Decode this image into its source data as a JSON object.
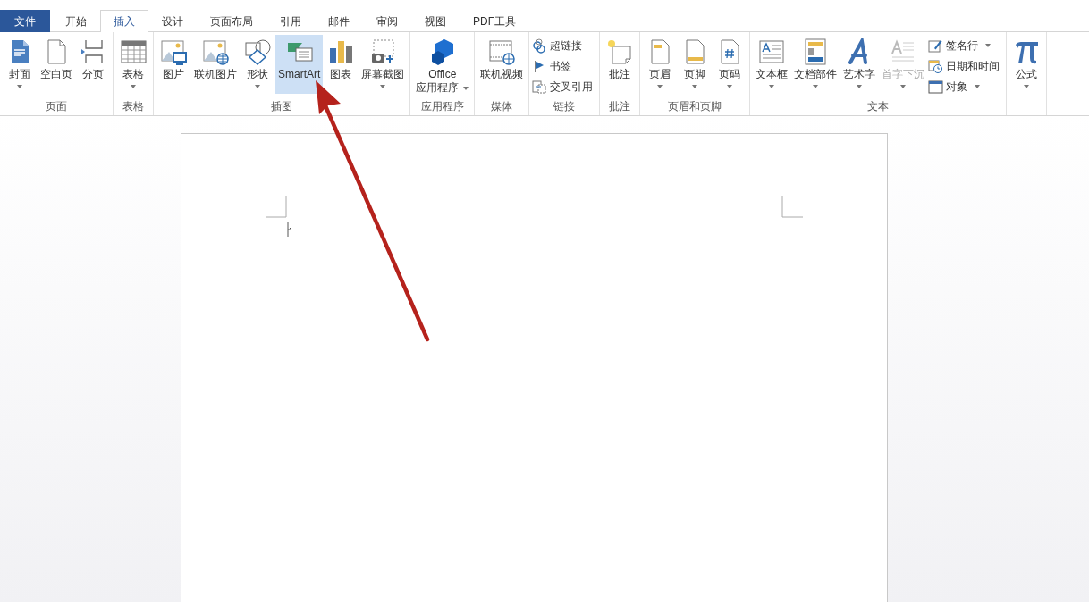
{
  "tabs": [
    {
      "label": "文件",
      "kind": "file",
      "selected": false
    },
    {
      "label": "开始",
      "kind": "tab",
      "selected": false
    },
    {
      "label": "插入",
      "kind": "tab",
      "selected": true
    },
    {
      "label": "设计",
      "kind": "tab",
      "selected": false
    },
    {
      "label": "页面布局",
      "kind": "tab",
      "selected": false
    },
    {
      "label": "引用",
      "kind": "tab",
      "selected": false
    },
    {
      "label": "邮件",
      "kind": "tab",
      "selected": false
    },
    {
      "label": "审阅",
      "kind": "tab",
      "selected": false
    },
    {
      "label": "视图",
      "kind": "tab",
      "selected": false
    },
    {
      "label": "PDF工具",
      "kind": "tab",
      "selected": false
    }
  ],
  "ribbon": {
    "groups": [
      {
        "label": "页面",
        "items": [
          {
            "kind": "large",
            "label": "封面",
            "dropdown": true,
            "highlighted": false,
            "disabled": false
          },
          {
            "kind": "large",
            "label": "空白页",
            "dropdown": false,
            "highlighted": false,
            "disabled": false
          },
          {
            "kind": "large",
            "label": "分页",
            "dropdown": false,
            "highlighted": false,
            "disabled": false
          }
        ]
      },
      {
        "label": "表格",
        "items": [
          {
            "kind": "large",
            "label": "表格",
            "dropdown": true,
            "highlighted": false,
            "disabled": false
          }
        ]
      },
      {
        "label": "插图",
        "items": [
          {
            "kind": "large",
            "label": "图片",
            "dropdown": false,
            "highlighted": false,
            "disabled": false
          },
          {
            "kind": "large",
            "label": "联机图片",
            "dropdown": false,
            "highlighted": false,
            "disabled": false
          },
          {
            "kind": "large",
            "label": "形状",
            "dropdown": true,
            "highlighted": false,
            "disabled": false
          },
          {
            "kind": "large",
            "label": "SmartArt",
            "dropdown": false,
            "highlighted": true,
            "disabled": false
          },
          {
            "kind": "large",
            "label": "图表",
            "dropdown": false,
            "highlighted": false,
            "disabled": false
          },
          {
            "kind": "large",
            "label": "屏幕截图",
            "dropdown": true,
            "highlighted": false,
            "disabled": false
          }
        ]
      },
      {
        "label": "应用程序",
        "items": [
          {
            "kind": "large",
            "label": "Office",
            "sublabel": "应用程序",
            "dropdown": true,
            "highlighted": false,
            "disabled": false
          }
        ]
      },
      {
        "label": "媒体",
        "items": [
          {
            "kind": "large",
            "label": "联机视频",
            "dropdown": false,
            "highlighted": false,
            "disabled": false
          }
        ]
      },
      {
        "label": "链接",
        "items": [
          {
            "kind": "stack",
            "items": [
              {
                "label": "超链接",
                "dropdown": false
              },
              {
                "label": "书签",
                "dropdown": false
              },
              {
                "label": "交叉引用",
                "dropdown": false
              }
            ]
          }
        ]
      },
      {
        "label": "批注",
        "items": [
          {
            "kind": "large",
            "label": "批注",
            "dropdown": false,
            "highlighted": false,
            "disabled": false
          }
        ]
      },
      {
        "label": "页眉和页脚",
        "items": [
          {
            "kind": "large",
            "label": "页眉",
            "dropdown": true,
            "highlighted": false,
            "disabled": false
          },
          {
            "kind": "large",
            "label": "页脚",
            "dropdown": true,
            "highlighted": false,
            "disabled": false
          },
          {
            "kind": "large",
            "label": "页码",
            "dropdown": true,
            "highlighted": false,
            "disabled": false
          }
        ]
      },
      {
        "label": "文本",
        "items": [
          {
            "kind": "large",
            "label": "文本框",
            "dropdown": true,
            "highlighted": false,
            "disabled": false
          },
          {
            "kind": "large",
            "label": "文档部件",
            "dropdown": true,
            "highlighted": false,
            "disabled": false
          },
          {
            "kind": "large",
            "label": "艺术字",
            "dropdown": true,
            "highlighted": false,
            "disabled": false
          },
          {
            "kind": "large",
            "label": "首字下沉",
            "dropdown": true,
            "highlighted": false,
            "disabled": true
          },
          {
            "kind": "stack",
            "items": [
              {
                "label": "签名行",
                "dropdown": true
              },
              {
                "label": "日期和时间",
                "dropdown": false
              },
              {
                "label": "对象",
                "dropdown": true
              }
            ]
          }
        ]
      },
      {
        "items": [
          {
            "kind": "large",
            "label": "公式",
            "dropdown": true,
            "highlighted": false,
            "disabled": false
          }
        ]
      }
    ]
  }
}
